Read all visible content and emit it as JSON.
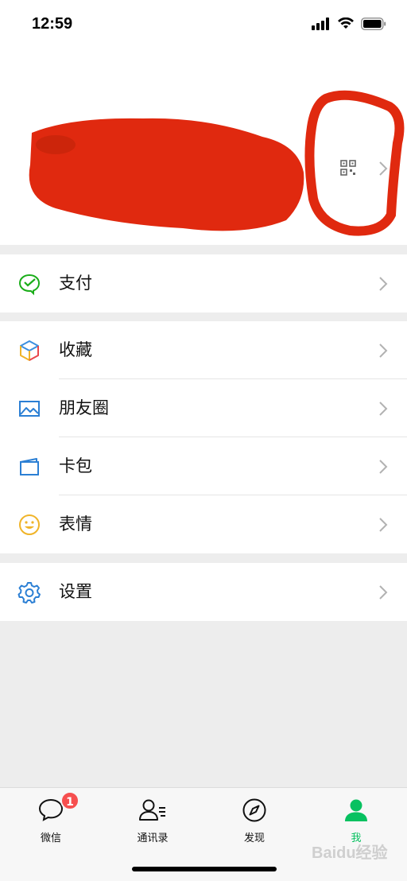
{
  "status_bar": {
    "time": "12:59"
  },
  "profile": {},
  "sections": {
    "pay": {
      "label": "支付"
    },
    "favorites": {
      "label": "收藏"
    },
    "moments": {
      "label": "朋友圈"
    },
    "cards": {
      "label": "卡包"
    },
    "stickers": {
      "label": "表情"
    },
    "settings": {
      "label": "设置"
    }
  },
  "tabbar": {
    "chats": {
      "label": "微信",
      "badge": "1"
    },
    "contacts": {
      "label": "通讯录"
    },
    "discover": {
      "label": "发现"
    },
    "me": {
      "label": "我"
    }
  },
  "watermark": "Baidu经验",
  "colors": {
    "accent": "#07c160",
    "badge": "#f64f4f",
    "redaction": "#e0290f"
  }
}
